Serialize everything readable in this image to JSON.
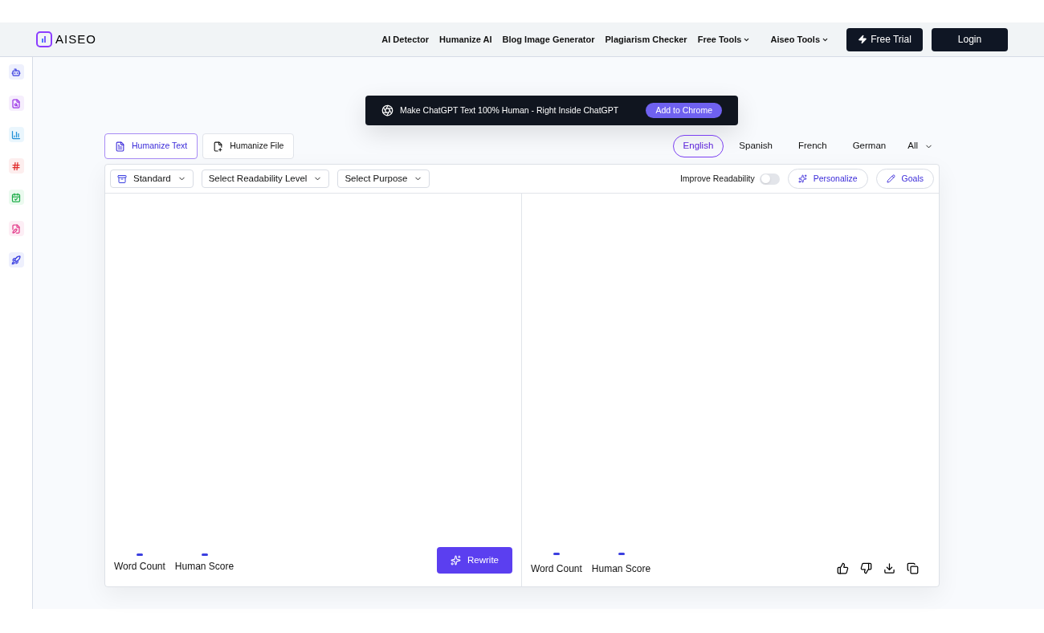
{
  "header": {
    "logo": "AISEO",
    "nav": [
      {
        "label": "AI Detector",
        "kind": "link"
      },
      {
        "label": "Humanize AI",
        "kind": "link"
      },
      {
        "label": "Blog Image Generator",
        "kind": "link"
      },
      {
        "label": "Plagiarism Checker",
        "kind": "link"
      },
      {
        "label": "Free Tools",
        "kind": "menu"
      },
      {
        "label": "Aiseo Tools",
        "kind": "menu"
      }
    ],
    "free_trial": "Free Trial",
    "login": "Login"
  },
  "banner": {
    "text": "Make ChatGPT Text 100% Human - Right Inside ChatGPT",
    "button": "Add to Chrome"
  },
  "mode_tabs": [
    {
      "label": "Humanize Text",
      "selected": true
    },
    {
      "label": "Humanize File",
      "selected": false
    }
  ],
  "languages": [
    {
      "label": "English",
      "selected": true
    },
    {
      "label": "Spanish",
      "selected": false
    },
    {
      "label": "French",
      "selected": false
    },
    {
      "label": "German",
      "selected": false
    }
  ],
  "language_menu": "All",
  "toolbar": {
    "dropdowns": [
      "Standard",
      "Select Readability Level",
      "Select Purpose"
    ],
    "improve_readability": {
      "label": "Improve Readability",
      "on": false
    },
    "personalize": "Personalize",
    "goals": "Goals"
  },
  "input_panel": {
    "stats": [
      "Word Count",
      "Human Score"
    ],
    "rewrite": "Rewrite"
  },
  "output_panel": {
    "stats": [
      "Word Count",
      "Human Score"
    ]
  }
}
